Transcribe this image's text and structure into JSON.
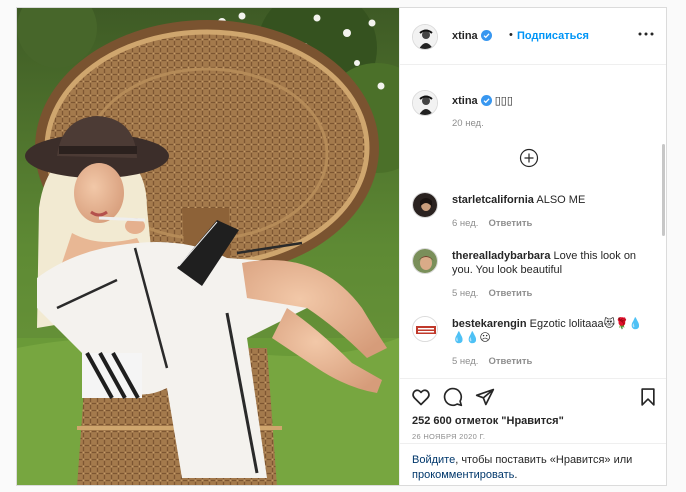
{
  "post": {
    "author": "xtina",
    "verified": true,
    "follow_label": "Подписаться",
    "separator": "•",
    "caption_text": "▯▯▯",
    "caption_time": "20 нед.",
    "photo_subject": "woman in white robe and black hat sitting in wicker peacock chair"
  },
  "comments": [
    {
      "user": "starletcalifornia",
      "text": "ALSO ME",
      "time": "6 нед.",
      "reply": "Ответить"
    },
    {
      "user": "therealladybarbara",
      "text": "Love this look on you. You look beautiful",
      "time": "5 нед.",
      "reply": "Ответить"
    },
    {
      "user": "bestekarengin",
      "text": "Egzotic lolitaaa😻🌹💧💧💧☹",
      "time": "5 нед.",
      "reply": "Ответить"
    }
  ],
  "actions": {
    "likes": "252 600 отметок \"Нравится\"",
    "date": "26 НОЯБРЯ 2020 Г."
  },
  "login_prompt": {
    "link1": "Войдите",
    "middle": ", чтобы поставить «Нравится» или",
    "link2": "прокомментировать",
    "end": "."
  },
  "icons": {
    "verified": "verified-badge-icon",
    "more": "more-options-icon",
    "load_more": "plus-circle-icon",
    "like": "heart-icon",
    "comment": "comment-icon",
    "share": "send-icon",
    "save": "bookmark-icon"
  },
  "colors": {
    "link": "#0095f6",
    "verified": "#3897f0",
    "muted": "#8e8e8e"
  }
}
